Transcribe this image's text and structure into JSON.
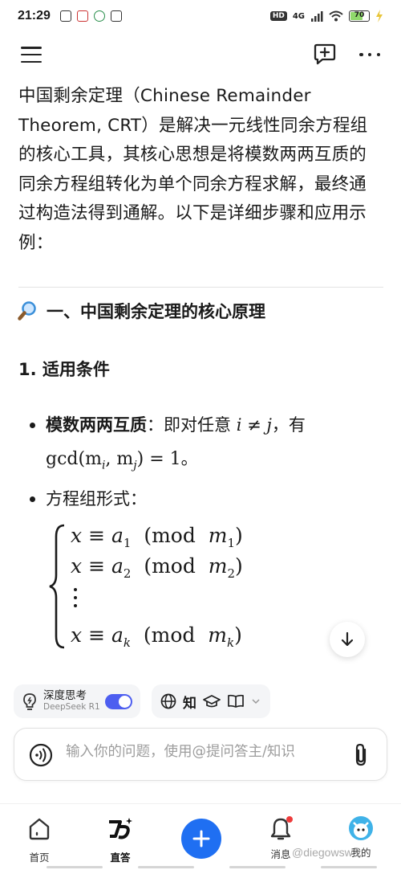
{
  "status_bar": {
    "time": "21:29",
    "network": "4G",
    "hd": "HD",
    "battery": "70"
  },
  "header": {
    "menu_icon": "menu-icon",
    "new_chat_icon": "new-chat-icon",
    "more_icon": "more-icon"
  },
  "article": {
    "intro": "中国剩余定理（Chinese Remainder Theorem, CRT）是解决一元线性同余方程组的核心工具，其核心思想是将模数两两互质的同余方程组转化为单个同余方程求解，最终通过构造法得到通解。以下是详细步骤和应用示例：",
    "section_title": "一、中国剩余定理的核心原理",
    "section_icon": "magnifier-icon",
    "subsection_title": "1. 适用条件",
    "bullet1_bold": "模数两两互质",
    "bullet1_text": "：即对任意 ",
    "bullet1_cond": "i ≠ j",
    "bullet1_have": "，有",
    "bullet1_gcd": "gcd(m",
    "bullet1_gcd_mi": "i",
    "bullet1_comma": ", m",
    "bullet1_gcd_mj": "j",
    "bullet1_end": ") = 1",
    "bullet1_period": "。",
    "bullet2": "方程组形式：",
    "equations": [
      {
        "lhs": "x",
        "rel": "≡",
        "a": "a",
        "a_sub": "1",
        "mod": "(mod",
        "m": "m",
        "m_sub": "1",
        "close": ")"
      },
      {
        "lhs": "x",
        "rel": "≡",
        "a": "a",
        "a_sub": "2",
        "mod": "(mod",
        "m": "m",
        "m_sub": "2",
        "close": ")"
      },
      {
        "lhs": "x",
        "rel": "≡",
        "a": "a",
        "a_sub": "k",
        "mod": "(mod",
        "m": "m",
        "m_sub": "k",
        "close": ")"
      }
    ]
  },
  "toolbar": {
    "deep_think_title": "深度思考",
    "deep_think_sub": "DeepSeek R1",
    "deep_think_on": true,
    "knowledge_label": "知"
  },
  "input": {
    "placeholder": "输入你的问题，使用@提问答主/知识"
  },
  "nav": {
    "items": [
      {
        "label": "首页",
        "icon": "home-icon"
      },
      {
        "label": "直答",
        "icon": "zhida-logo-icon",
        "active": true
      },
      {
        "label": "",
        "icon": "plus-icon"
      },
      {
        "label": "消息",
        "icon": "bell-icon"
      },
      {
        "label": "我的",
        "icon": "avatar-icon"
      }
    ],
    "watermark": "@diegowsw3"
  },
  "colors": {
    "accent": "#1f6ff2",
    "toggle": "#4d5ef0",
    "alert": "#ee3b3b"
  }
}
